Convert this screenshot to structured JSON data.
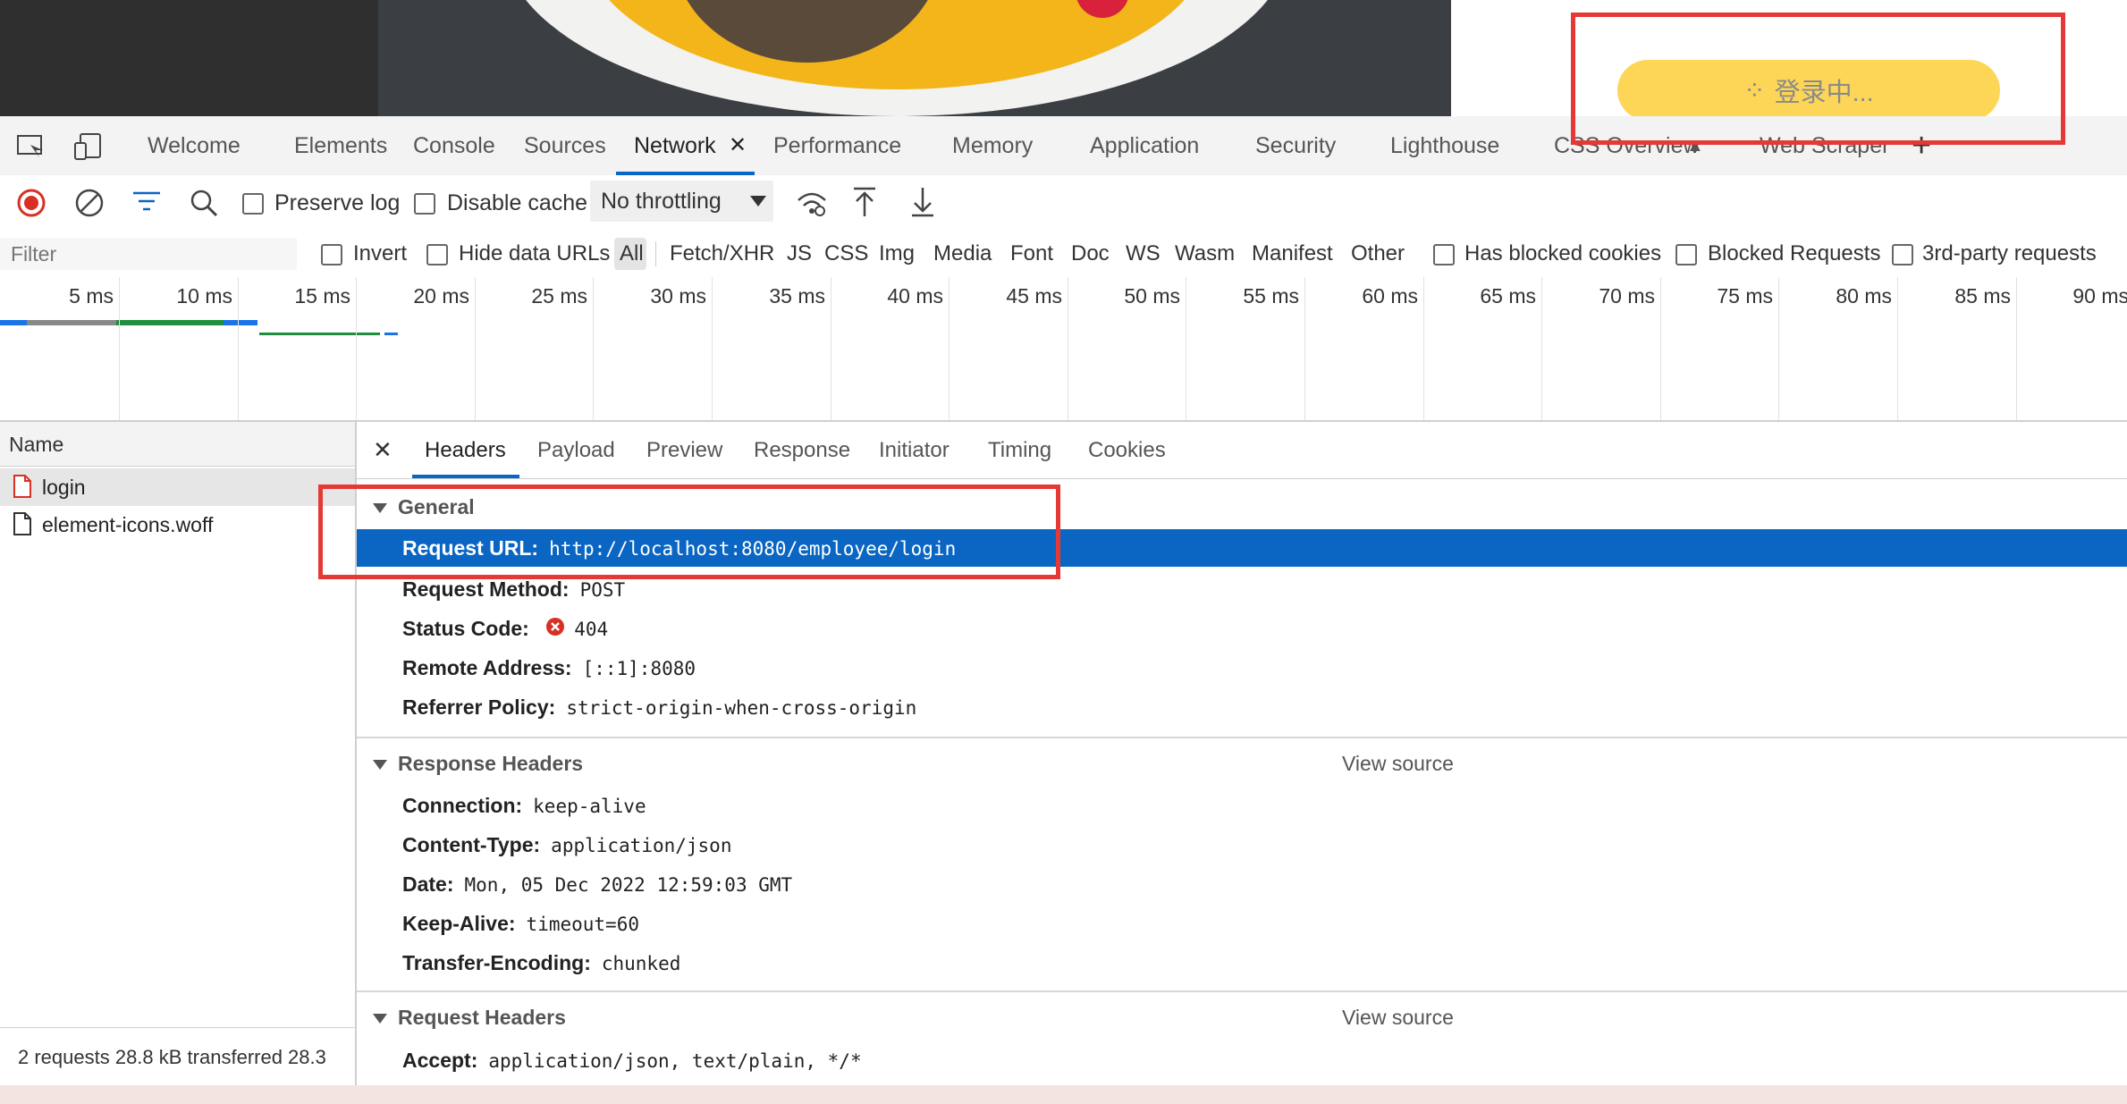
{
  "page": {
    "login_button": "登录中..."
  },
  "devtools": {
    "tabs": [
      "Welcome",
      "Elements",
      "Console",
      "Sources",
      "Network",
      "Performance",
      "Memory",
      "Application",
      "Security",
      "Lighthouse",
      "CSS Overview",
      "Web Scraper"
    ],
    "active_tab": "Network",
    "close_glyph": "✕",
    "add_glyph": "+"
  },
  "toolbar": {
    "preserve_log": "Preserve log",
    "disable_cache": "Disable cache",
    "throttling": "No throttling"
  },
  "filter": {
    "placeholder": "Filter",
    "invert": "Invert",
    "hide_data_urls": "Hide data URLs",
    "types": [
      "All",
      "Fetch/XHR",
      "JS",
      "CSS",
      "Img",
      "Media",
      "Font",
      "Doc",
      "WS",
      "Wasm",
      "Manifest",
      "Other"
    ],
    "has_blocked_cookies": "Has blocked cookies",
    "blocked_requests": "Blocked Requests",
    "third_party": "3rd-party requests"
  },
  "overview": {
    "ticks": [
      "5 ms",
      "10 ms",
      "15 ms",
      "20 ms",
      "25 ms",
      "30 ms",
      "35 ms",
      "40 ms",
      "45 ms",
      "50 ms",
      "55 ms",
      "60 ms",
      "65 ms",
      "70 ms",
      "75 ms",
      "80 ms",
      "85 ms",
      "90 ms"
    ]
  },
  "requests": {
    "header": "Name",
    "items": [
      "login",
      "element-icons.woff"
    ],
    "summary": "2 requests   28.8 kB transferred   28.3"
  },
  "details": {
    "tabs": [
      "Headers",
      "Payload",
      "Preview",
      "Response",
      "Initiator",
      "Timing",
      "Cookies"
    ],
    "active_tab": "Headers",
    "general": {
      "title": "General",
      "rows": [
        {
          "k": "Request URL:",
          "v": "http://localhost:8080/employee/login"
        },
        {
          "k": "Request Method:",
          "v": "POST"
        },
        {
          "k": "Status Code:",
          "v": "404"
        },
        {
          "k": "Remote Address:",
          "v": "[::1]:8080"
        },
        {
          "k": "Referrer Policy:",
          "v": "strict-origin-when-cross-origin"
        }
      ]
    },
    "response_headers": {
      "title": "Response Headers",
      "view_source": "View source",
      "rows": [
        {
          "k": "Connection:",
          "v": "keep-alive"
        },
        {
          "k": "Content-Type:",
          "v": "application/json"
        },
        {
          "k": "Date:",
          "v": "Mon, 05 Dec 2022 12:59:03 GMT"
        },
        {
          "k": "Keep-Alive:",
          "v": "timeout=60"
        },
        {
          "k": "Transfer-Encoding:",
          "v": "chunked"
        }
      ]
    },
    "request_headers": {
      "title": "Request Headers",
      "view_source": "View source",
      "rows": [
        {
          "k": "Accept:",
          "v": "application/json, text/plain, */*"
        }
      ]
    }
  },
  "colors": {
    "accent": "#0a66c2",
    "highlight": "#e53935",
    "login_button": "#fdd657",
    "status_error": "#d93025"
  }
}
